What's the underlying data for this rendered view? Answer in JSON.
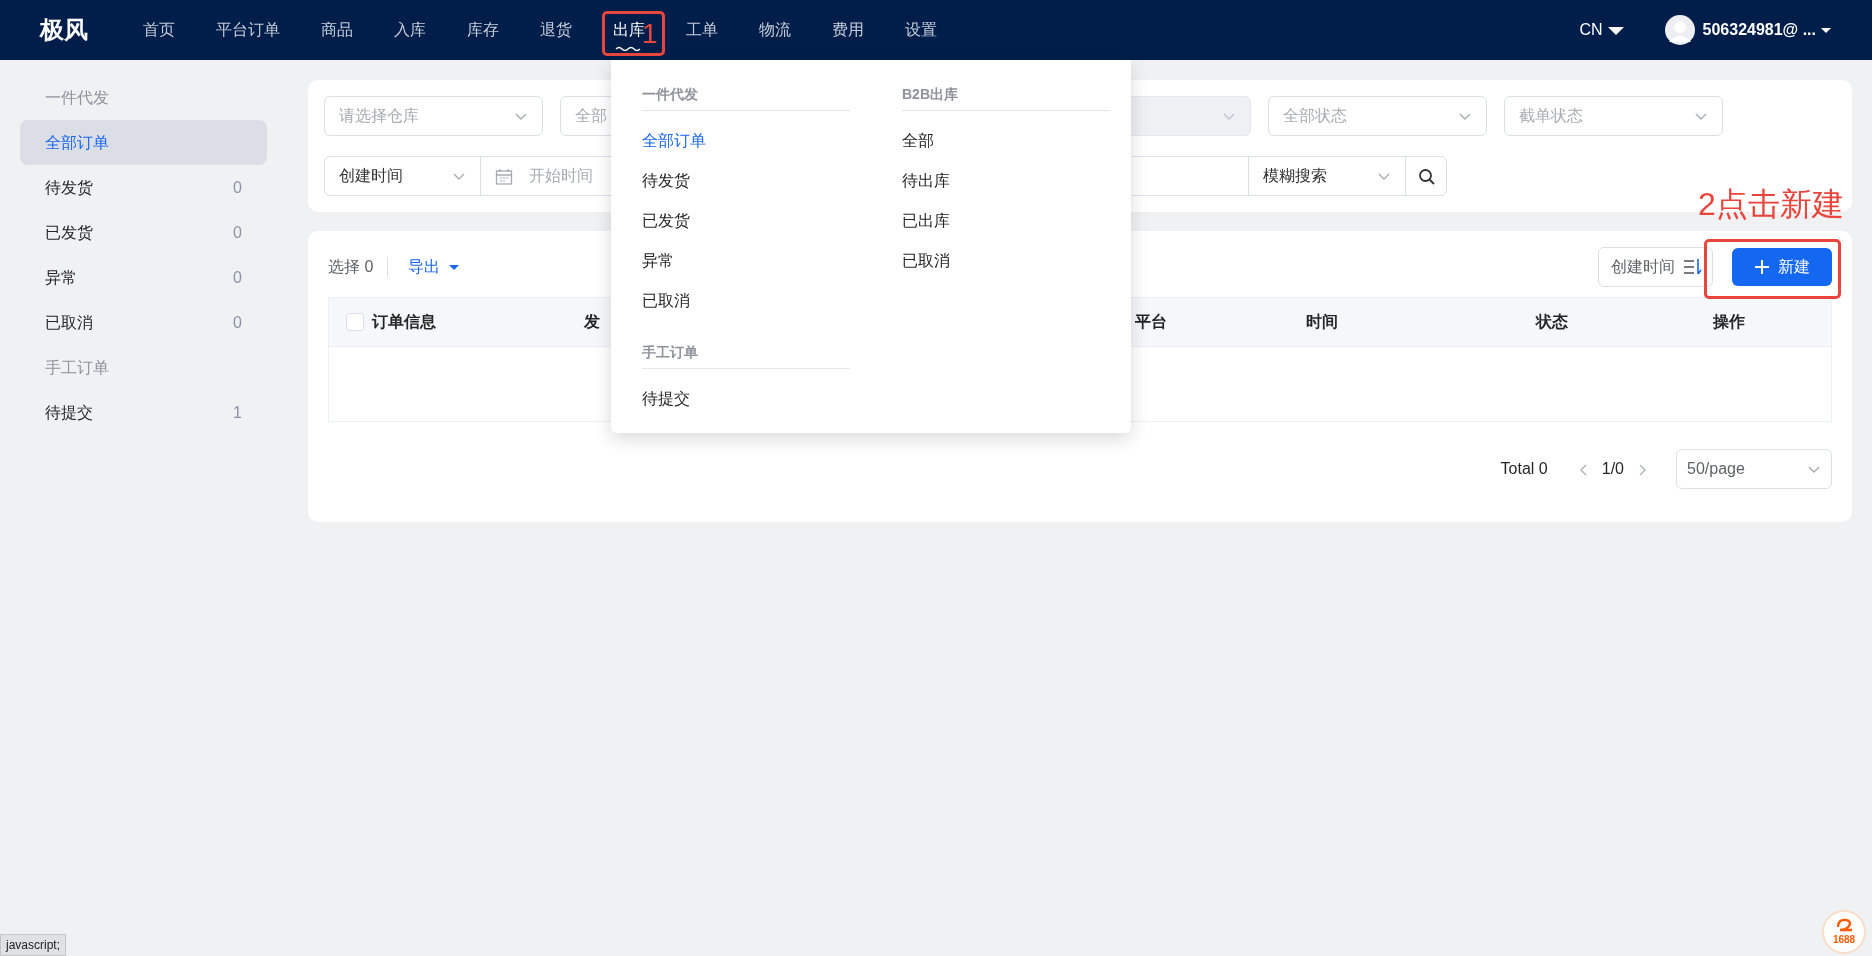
{
  "navbar": {
    "logo": "极风",
    "items": [
      {
        "label": "首页",
        "selected": false
      },
      {
        "label": "平台订单",
        "selected": false
      },
      {
        "label": "商品",
        "selected": false
      },
      {
        "label": "入库",
        "selected": false
      },
      {
        "label": "库存",
        "selected": false
      },
      {
        "label": "退货",
        "selected": false
      },
      {
        "label": "出库",
        "selected": true
      },
      {
        "label": "工单",
        "selected": false
      },
      {
        "label": "物流",
        "selected": false
      },
      {
        "label": "费用",
        "selected": false
      },
      {
        "label": "设置",
        "selected": false
      }
    ],
    "annotation": "1",
    "language": "CN",
    "user": "506324981@ ..."
  },
  "sidebar": {
    "groups": [
      {
        "title": "一件代发",
        "items": [
          {
            "label": "全部订单",
            "selected": true
          },
          {
            "label": "待发货",
            "count": "0",
            "selected": false
          },
          {
            "label": "已发货",
            "count": "0",
            "selected": false
          },
          {
            "label": "异常",
            "count": "0",
            "selected": false
          },
          {
            "label": "已取消",
            "count": "0",
            "selected": false
          }
        ]
      },
      {
        "title": "手工订单",
        "items": [
          {
            "label": "待提交",
            "count": "1",
            "selected": false
          }
        ]
      }
    ]
  },
  "filters": {
    "selects": [
      {
        "placeholder": "请选择仓库",
        "disabled": false
      },
      {
        "placeholder": "全部"
      },
      {
        "disabled": true
      },
      {
        "placeholder": "全部状态",
        "disabled": false
      },
      {
        "placeholder": "截单状态",
        "disabled": false
      }
    ],
    "date_type": "创建时间",
    "date_start": {
      "placeholder": "开始时间"
    },
    "search_type": "模糊搜索"
  },
  "menu": {
    "columns": [
      {
        "groups": [
          {
            "title": "一件代发",
            "items": [
              {
                "label": "全部订单",
                "selected": true
              },
              {
                "label": "待发货",
                "selected": false
              },
              {
                "label": "已发货",
                "selected": false
              },
              {
                "label": "异常",
                "selected": false
              },
              {
                "label": "已取消",
                "selected": false
              }
            ]
          },
          {
            "title": "手工订单",
            "items": [
              {
                "label": "待提交",
                "selected": false
              }
            ]
          }
        ]
      },
      {
        "groups": [
          {
            "title": "B2B出库",
            "items": [
              {
                "label": "全部",
                "selected": false
              },
              {
                "label": "待出库",
                "selected": false
              },
              {
                "label": "已出库",
                "selected": false
              },
              {
                "label": "已取消",
                "selected": false
              }
            ]
          }
        ]
      }
    ]
  },
  "orders": {
    "selected_label": "选择",
    "selected_count": "0",
    "export": "导出",
    "sort": "创建时间",
    "new_button": "新建",
    "annotation": "2点击新建",
    "select_all_checked": false,
    "columns": [
      "订单信息",
      "发",
      "平台",
      "时间",
      "状态",
      "操作"
    ],
    "pagination": {
      "total": "Total 0",
      "page": "1/0",
      "page_size": "50/page"
    }
  },
  "status_text": "javascript;",
  "corner_badge": "1688"
}
